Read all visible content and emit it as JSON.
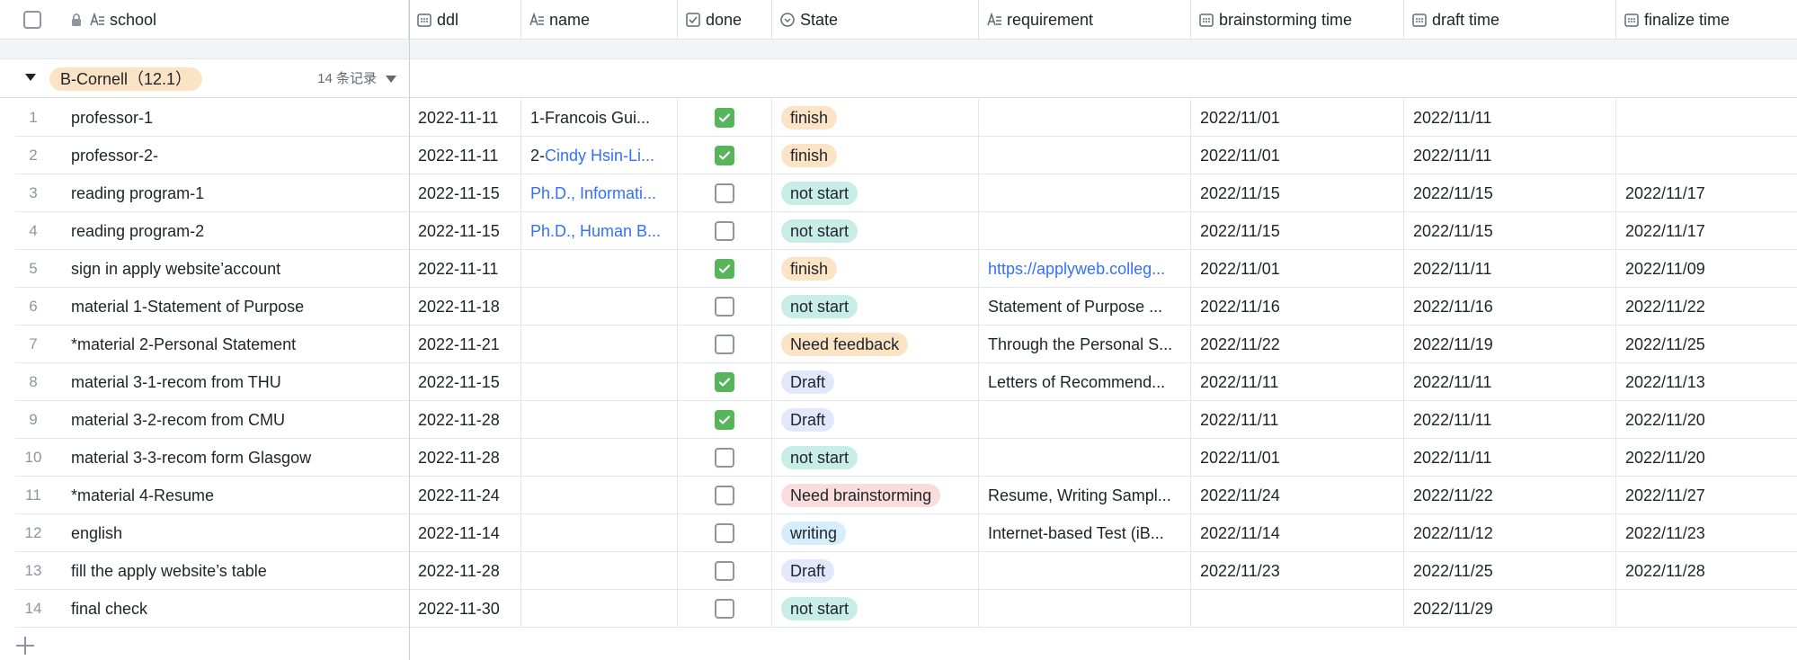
{
  "columns": {
    "school": "school",
    "ddl": "ddl",
    "name": "name",
    "done": "done",
    "state": "State",
    "requirement": "requirement",
    "brainstorming": "brainstorming time",
    "draft": "draft time",
    "finalize": "finalize time"
  },
  "group": {
    "label": "B-Cornell（12.1）",
    "count": "14 条记录"
  },
  "colors": {
    "finish": "#fbe3c6",
    "not_start": "#c8ece6",
    "need_feedback": "#fbe3c6",
    "draft": "#e1e8fc",
    "need_brainstorming": "#fbdcdc",
    "writing": "#d6eefc"
  },
  "rows": [
    {
      "num": "1",
      "school": "professor-1",
      "ddl": "2022-11-11",
      "name_prefix": "1-Francois Gui...",
      "name_link": "",
      "done": true,
      "state": "finish",
      "state_color": "#fbe3c6",
      "requirement": "",
      "req_link": false,
      "brainstorming": "2022/11/01",
      "draft": "2022/11/11",
      "finalize": ""
    },
    {
      "num": "2",
      "school": "professor-2-",
      "ddl": "2022-11-11",
      "name_prefix": "2-",
      "name_link": "Cindy Hsin-Li...",
      "done": true,
      "state": "finish",
      "state_color": "#fbe3c6",
      "requirement": "",
      "req_link": false,
      "brainstorming": "2022/11/01",
      "draft": "2022/11/11",
      "finalize": ""
    },
    {
      "num": "3",
      "school": "reading program-1",
      "ddl": "2022-11-15",
      "name_prefix": "",
      "name_link": "Ph.D., Informati...",
      "done": false,
      "state": "not start",
      "state_color": "#c8ece6",
      "requirement": "",
      "req_link": false,
      "brainstorming": "2022/11/15",
      "draft": "2022/11/15",
      "finalize": "2022/11/17"
    },
    {
      "num": "4",
      "school": "reading program-2",
      "ddl": "2022-11-15",
      "name_prefix": "",
      "name_link": "Ph.D., Human B...",
      "done": false,
      "state": "not start",
      "state_color": "#c8ece6",
      "requirement": "",
      "req_link": false,
      "brainstorming": "2022/11/15",
      "draft": "2022/11/15",
      "finalize": "2022/11/17"
    },
    {
      "num": "5",
      "school": "sign in apply website’account",
      "ddl": "2022-11-11",
      "name_prefix": "",
      "name_link": "",
      "done": true,
      "state": "finish",
      "state_color": "#fbe3c6",
      "requirement": "https://applyweb.colleg...",
      "req_link": true,
      "brainstorming": "2022/11/01",
      "draft": "2022/11/11",
      "finalize": "2022/11/09"
    },
    {
      "num": "6",
      "school": "material 1-Statement of Purpose",
      "ddl": "2022-11-18",
      "name_prefix": "",
      "name_link": "",
      "done": false,
      "state": "not start",
      "state_color": "#c8ece6",
      "requirement": "Statement of Purpose ...",
      "req_link": false,
      "brainstorming": "2022/11/16",
      "draft": "2022/11/16",
      "finalize": "2022/11/22"
    },
    {
      "num": "7",
      "school": "*material 2-Personal Statement",
      "ddl": "2022-11-21",
      "name_prefix": "",
      "name_link": "",
      "done": false,
      "state": "Need feedback",
      "state_color": "#fbe3c6",
      "requirement": "Through the Personal S...",
      "req_link": false,
      "brainstorming": "2022/11/22",
      "draft": "2022/11/19",
      "finalize": "2022/11/25"
    },
    {
      "num": "8",
      "school": "material 3-1-recom from THU",
      "ddl": "2022-11-15",
      "name_prefix": "",
      "name_link": "",
      "done": true,
      "state": "Draft",
      "state_color": "#e1e8fc",
      "requirement": "Letters of Recommend...",
      "req_link": false,
      "brainstorming": "2022/11/11",
      "draft": "2022/11/11",
      "finalize": "2022/11/13"
    },
    {
      "num": "9",
      "school": "material 3-2-recom from CMU",
      "ddl": "2022-11-28",
      "name_prefix": "",
      "name_link": "",
      "done": true,
      "state": "Draft",
      "state_color": "#e1e8fc",
      "requirement": "",
      "req_link": false,
      "brainstorming": "2022/11/11",
      "draft": "2022/11/11",
      "finalize": "2022/11/20"
    },
    {
      "num": "10",
      "school": "material 3-3-recom form Glasgow",
      "ddl": "2022-11-28",
      "name_prefix": "",
      "name_link": "",
      "done": false,
      "state": "not start",
      "state_color": "#c8ece6",
      "requirement": "",
      "req_link": false,
      "brainstorming": "2022/11/01",
      "draft": "2022/11/11",
      "finalize": "2022/11/20"
    },
    {
      "num": "11",
      "school": "*material 4-Resume",
      "ddl": "2022-11-24",
      "name_prefix": "",
      "name_link": "",
      "done": false,
      "state": "Need brainstorming",
      "state_color": "#fbdcdc",
      "requirement": "Resume, Writing Sampl...",
      "req_link": false,
      "brainstorming": "2022/11/24",
      "draft": "2022/11/22",
      "finalize": "2022/11/27"
    },
    {
      "num": "12",
      "school": "english",
      "ddl": "2022-11-14",
      "name_prefix": "",
      "name_link": "",
      "done": false,
      "state": "writing",
      "state_color": "#d6eefc",
      "requirement": "Internet-based Test (iB...",
      "req_link": false,
      "brainstorming": "2022/11/14",
      "draft": "2022/11/12",
      "finalize": "2022/11/23"
    },
    {
      "num": "13",
      "school": "fill the apply website’s table",
      "ddl": "2022-11-28",
      "name_prefix": "",
      "name_link": "",
      "done": false,
      "state": "Draft",
      "state_color": "#e1e8fc",
      "requirement": "",
      "req_link": false,
      "brainstorming": "2022/11/23",
      "draft": "2022/11/25",
      "finalize": "2022/11/28"
    },
    {
      "num": "14",
      "school": "final check",
      "ddl": "2022-11-30",
      "name_prefix": "",
      "name_link": "",
      "done": false,
      "state": "not start",
      "state_color": "#c8ece6",
      "requirement": "",
      "req_link": false,
      "brainstorming": "",
      "draft": "2022/11/29",
      "finalize": ""
    }
  ]
}
